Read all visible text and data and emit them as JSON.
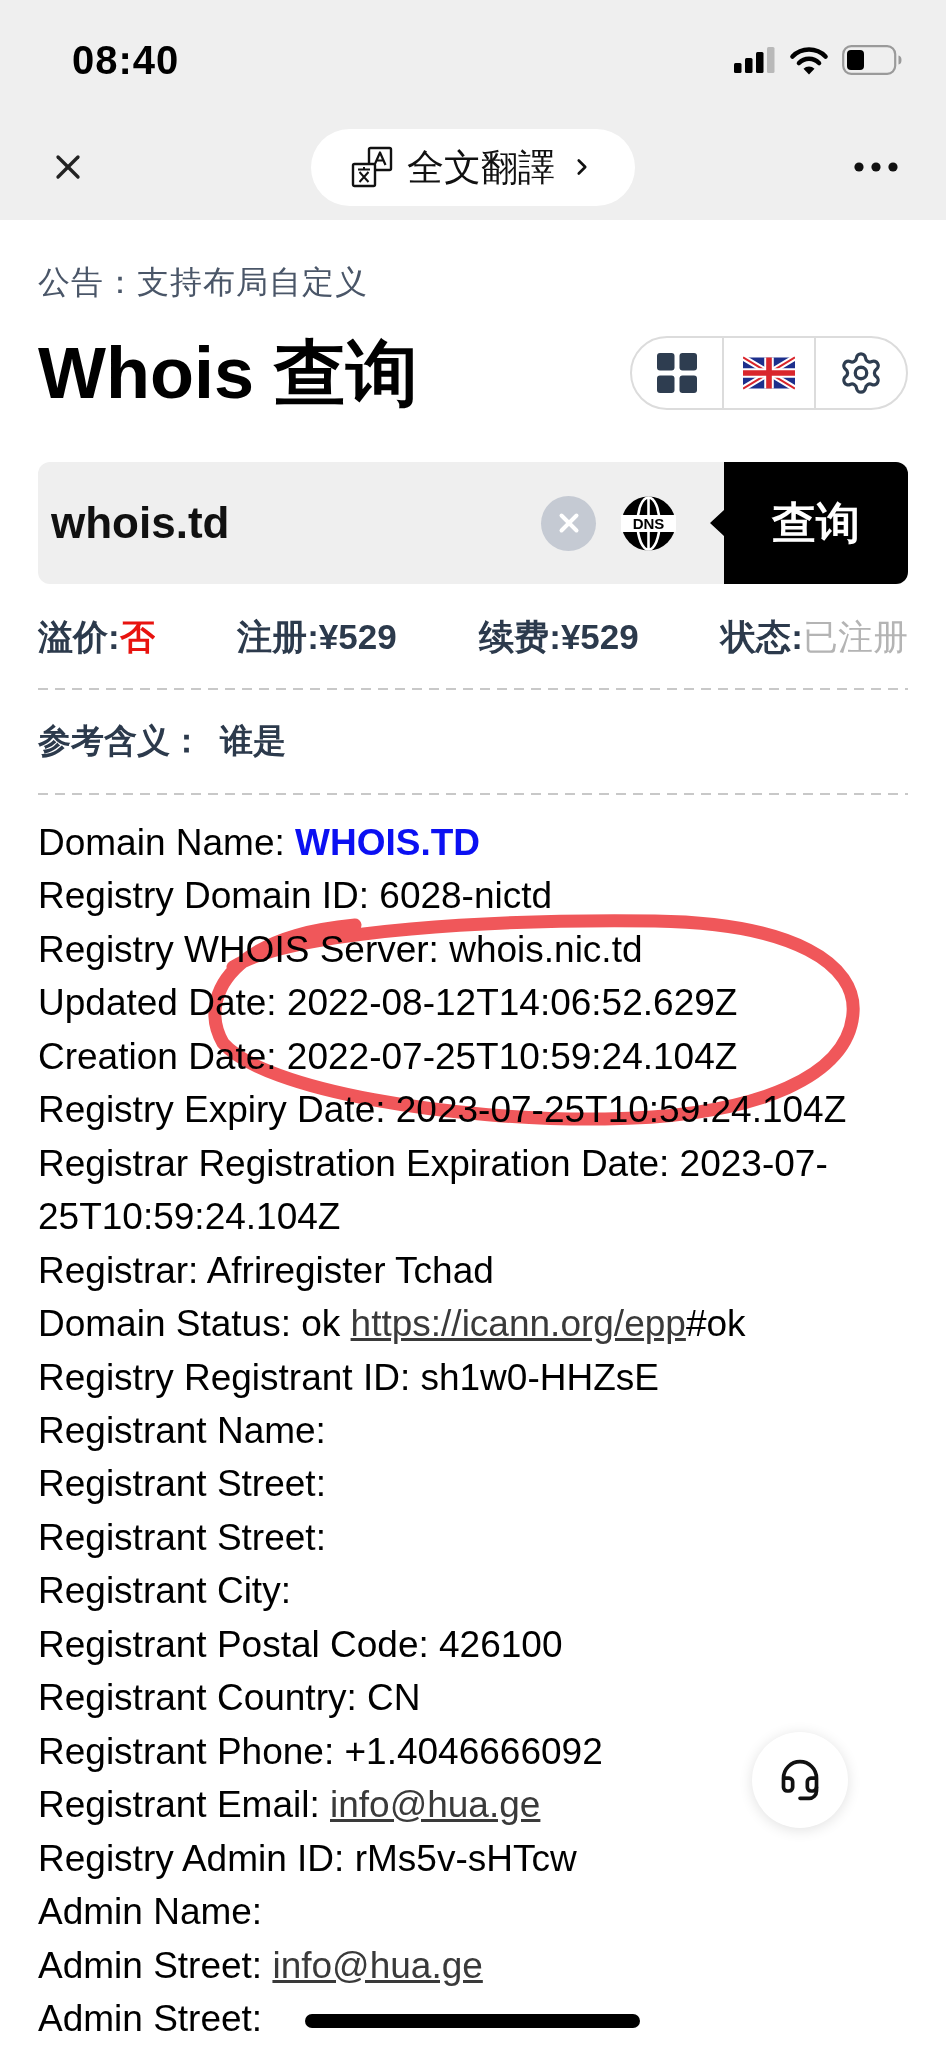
{
  "status_bar": {
    "time": "08:40"
  },
  "toolbar": {
    "translate_button": "全文翻譯"
  },
  "announcement": "公告：支持布局自定义",
  "title": "Whois 查询",
  "search": {
    "value": "whois.td",
    "dns_label": "DNS",
    "button": "查询"
  },
  "stats": [
    {
      "label": "溢价:",
      "value": "否",
      "kind": "alert"
    },
    {
      "label": "注册:",
      "value": "¥529",
      "kind": "normal"
    },
    {
      "label": "续费:",
      "value": "¥529",
      "kind": "normal"
    },
    {
      "label": "状态:",
      "value": "已注册",
      "kind": "muted"
    }
  ],
  "meaning": {
    "label": "参考含义：",
    "value": "谁是"
  },
  "whois_lines": [
    {
      "kind": "emphasis",
      "label": "Domain Name:",
      "value": "WHOIS.TD"
    },
    {
      "kind": "plain",
      "label": "Registry Domain ID:",
      "value": "6028-nictd"
    },
    {
      "kind": "plain",
      "label": "Registry WHOIS Server:",
      "value": "whois.nic.td"
    },
    {
      "kind": "plain",
      "label": "Updated Date:",
      "value": "2022-08-12T14:06:52.629Z"
    },
    {
      "kind": "plain",
      "label": "Creation Date:",
      "value": "2022-07-25T10:59:24.104Z"
    },
    {
      "kind": "plain",
      "label": "Registry Expiry Date:",
      "value": "2023-07-25T10:59:24.104Z"
    },
    {
      "kind": "plain",
      "label": "Registrar Registration Expiration Date:",
      "value": "2023-07-25T10:59:24.104Z"
    },
    {
      "kind": "plain",
      "label": "Registrar:",
      "value": "Afriregister Tchad"
    },
    {
      "kind": "link",
      "label": "Domain Status:",
      "value": "ok",
      "link": "https://icann.org/epp",
      "link_suffix": "#ok"
    },
    {
      "kind": "plain",
      "label": "Registry Registrant ID:",
      "value": "sh1w0-HHZsE"
    },
    {
      "kind": "plain",
      "label": "Registrant Name:"
    },
    {
      "kind": "plain",
      "label": "Registrant Street:"
    },
    {
      "kind": "plain",
      "label": "Registrant Street:"
    },
    {
      "kind": "plain",
      "label": "Registrant City:"
    },
    {
      "kind": "plain",
      "label": "Registrant Postal Code:",
      "value": "426100"
    },
    {
      "kind": "plain",
      "label": "Registrant Country:",
      "value": "CN"
    },
    {
      "kind": "plain",
      "label": "Registrant Phone:",
      "value": "+1.4046666092"
    },
    {
      "kind": "link",
      "label": "Registrant Email:",
      "link": "info@hua.ge"
    },
    {
      "kind": "plain",
      "label": "Registry Admin ID:",
      "value": "rMs5v-sHTcw"
    },
    {
      "kind": "plain",
      "label": "Admin Name:"
    },
    {
      "kind": "link",
      "label": "Admin Street:",
      "link": "info@hua.ge"
    },
    {
      "kind": "plain",
      "label": "Admin Street:"
    }
  ]
}
